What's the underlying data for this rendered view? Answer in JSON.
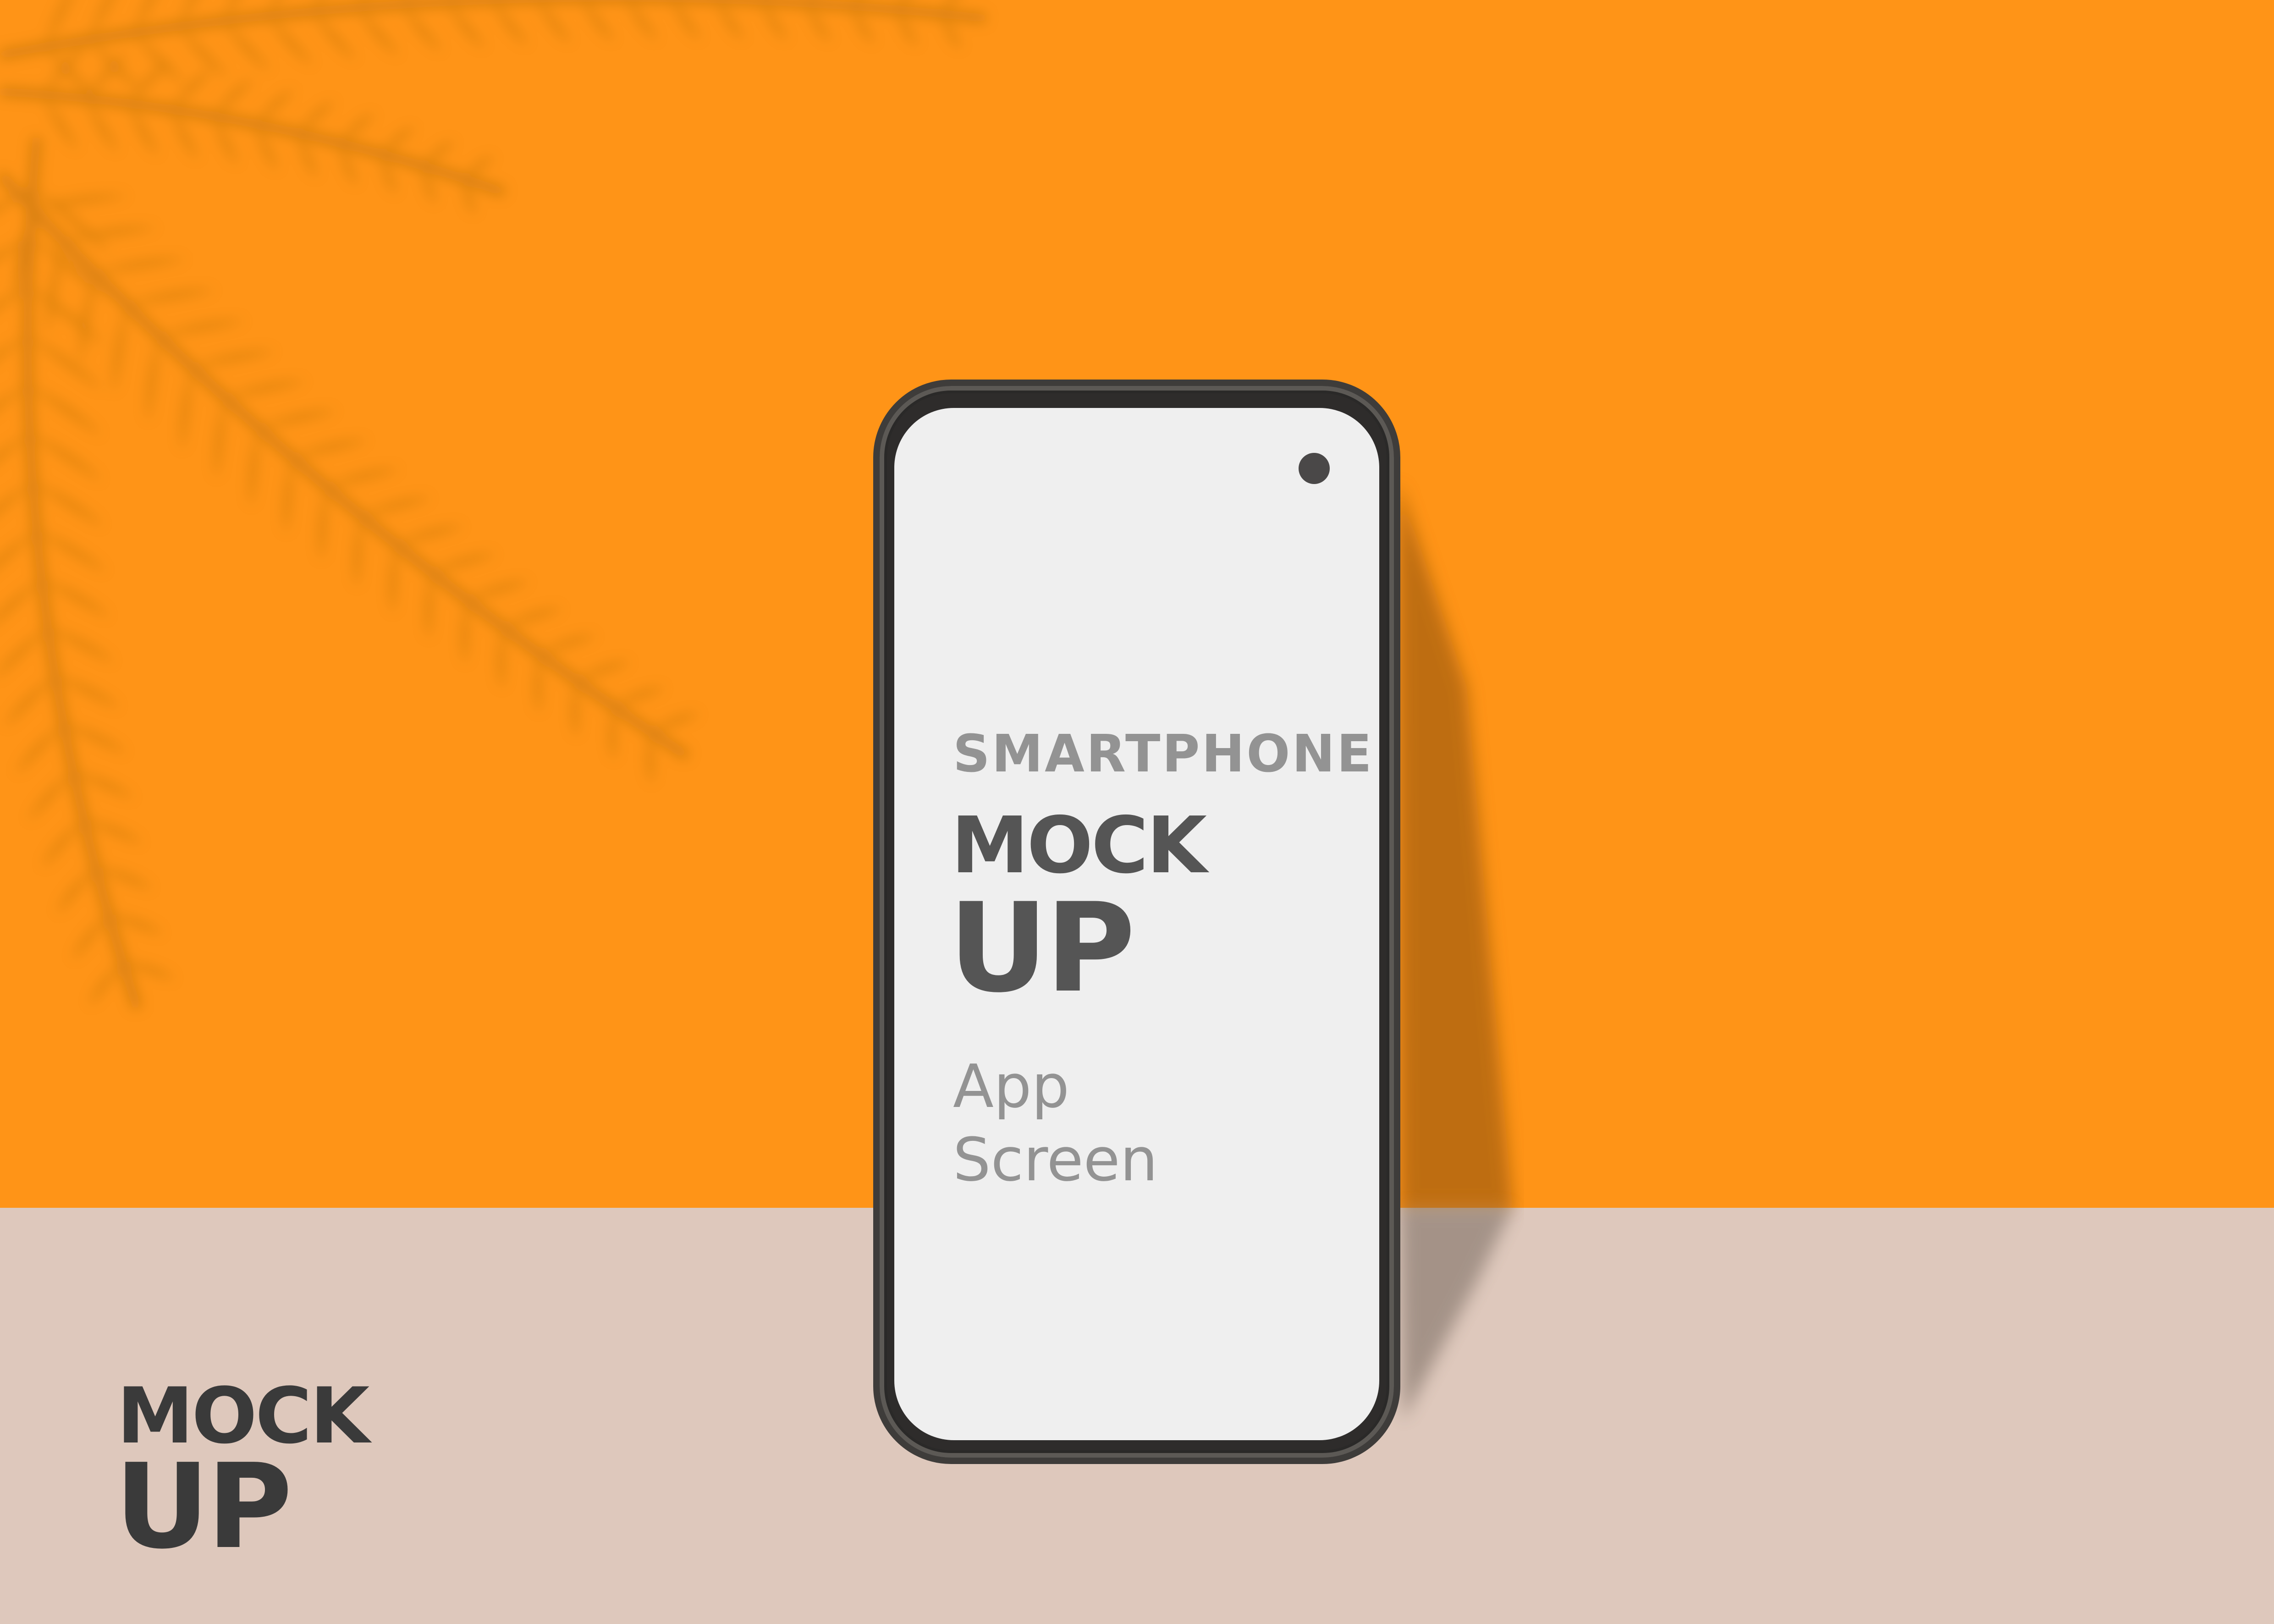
{
  "colors": {
    "wall": "#ff9417",
    "floor": "#dec8bc",
    "screen": "#efefef",
    "frame": "#3e3c3a",
    "camera": "#4a4848",
    "label_light": "#939393",
    "label_dark": "#555555",
    "logo": "#3a3a3a",
    "leaf_shadow": "#b8700f"
  },
  "phone": {
    "screen": {
      "label": "SMARTPHONE",
      "title_line1": "MOCK",
      "title_line2": "UP",
      "subtitle_line1": "App",
      "subtitle_line2": "Screen"
    }
  },
  "logo": {
    "line1": "MOCK",
    "line2": "UP"
  },
  "decor": {
    "leaf": "palm-leaf-shadow",
    "camera": "front-camera-icon"
  }
}
